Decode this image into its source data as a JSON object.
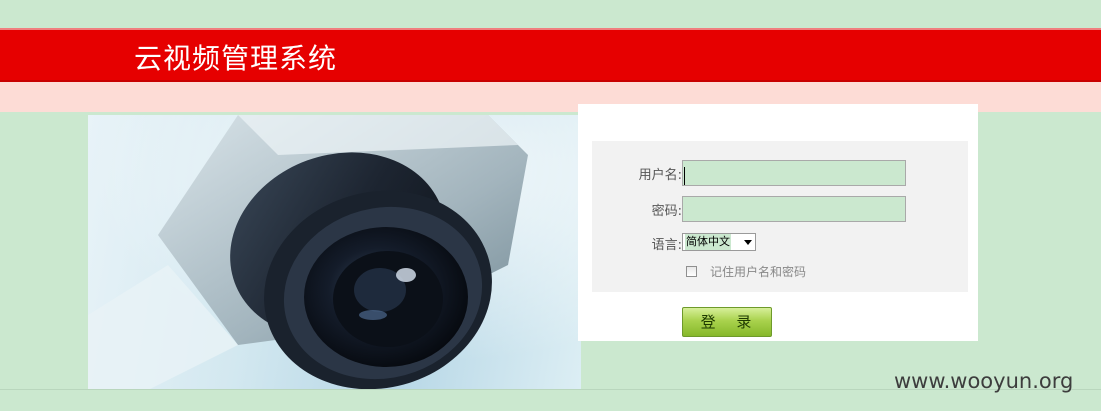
{
  "header": {
    "title": "云视频管理系统"
  },
  "login_form": {
    "username_label": "用户名:",
    "username_value": "",
    "password_label": "密码:",
    "password_value": "",
    "language_label": "语言:",
    "language_selected": "简体中文",
    "remember_label": "记住用户名和密码",
    "remember_checked": false,
    "submit_label": "登 录"
  },
  "watermark": "www.wooyun.org",
  "colors": {
    "page_background": "#cbe8cf",
    "header_red": "#e60000",
    "pink_band": "#fddcd6",
    "input_background": "#cbe8cf",
    "button_green": "#a9d24d"
  },
  "icons": {
    "hero_image": "security-camera-photo",
    "dropdown": "dropdown-arrow-icon"
  }
}
